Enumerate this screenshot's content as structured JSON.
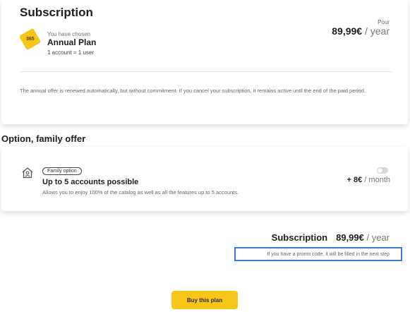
{
  "subscription": {
    "title": "Subscription",
    "chosen_label": "You have chosen",
    "plan_logo_text": "365",
    "plan_name": "Annual Plan",
    "plan_accounts": "1 account = 1 user",
    "pour_label": "Pour",
    "price_amount": "89,99€",
    "price_period": " / year",
    "renewal_note": "The annual offer is renewed automatically, but without commitment. If you cancel your subscription, it remains active until the end of the paid period."
  },
  "option": {
    "heading": "Option, family offer",
    "icon": "family-house-icon",
    "badge": "Family option",
    "title": "Up to 5 accounts possible",
    "description": "Allows you to enjoy 100% of the catalog as well as all the features up to 5 accounts.",
    "toggle_on": false,
    "price_amount": "+ 8€",
    "price_period": " / month"
  },
  "summary": {
    "label": "Subscription",
    "price_amount": "89,99€",
    "price_period": " / year",
    "promo_note": "If you have a promo code, it will be filled in the next step"
  },
  "cta": {
    "buy_label": "Buy this plan"
  },
  "colors": {
    "accent_yellow": "#f7c619",
    "highlight_blue": "#3d7ad6"
  }
}
